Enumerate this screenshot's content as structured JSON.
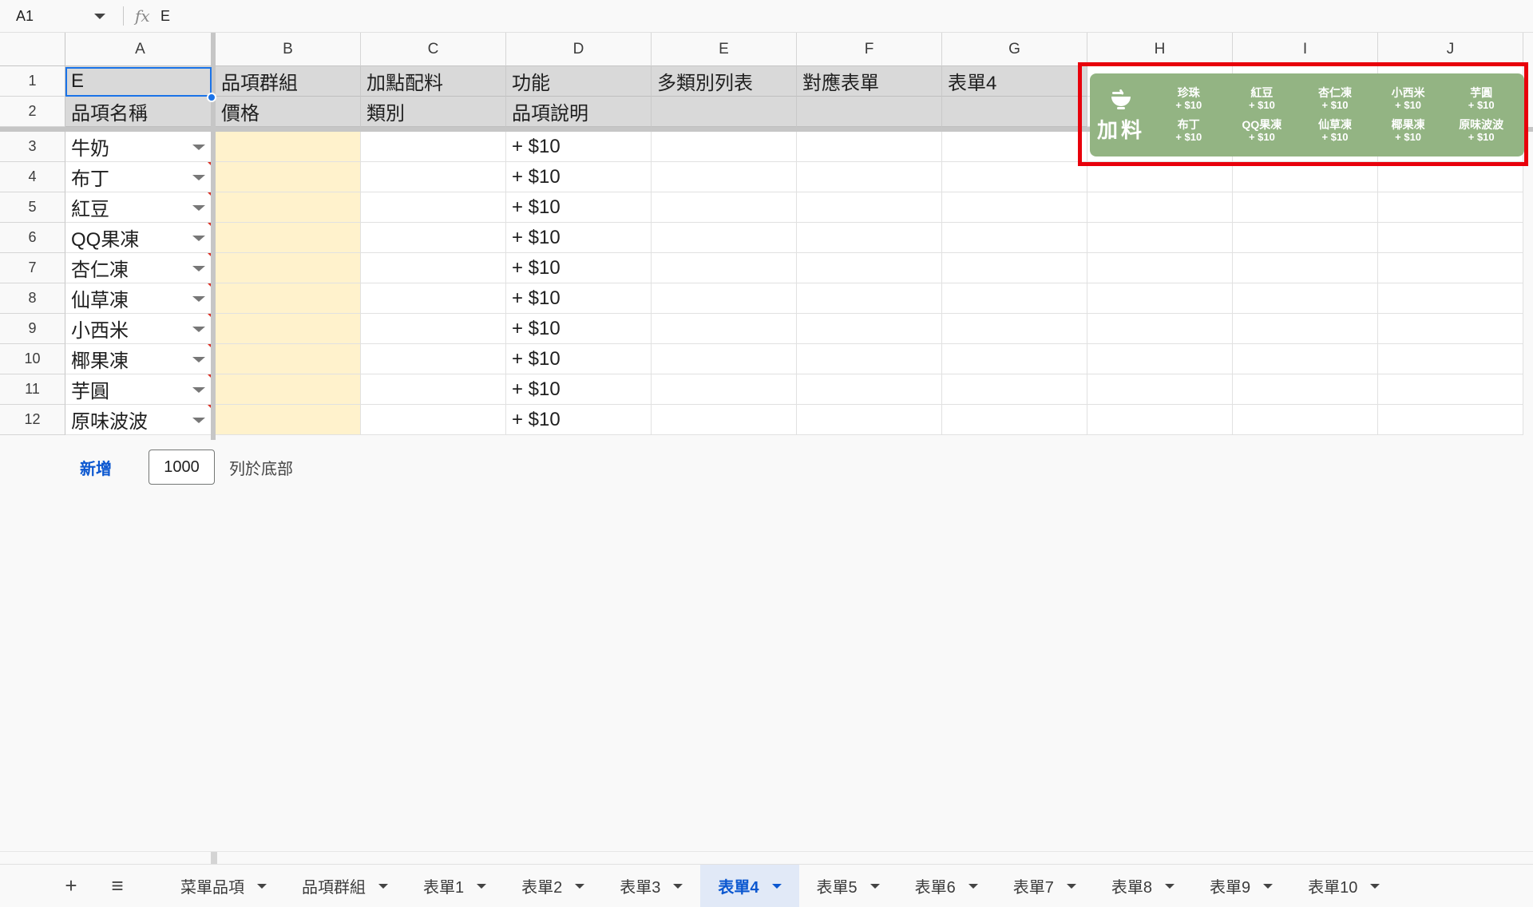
{
  "formula_bar": {
    "cell_ref": "A1",
    "fx_label": "fx",
    "value": "E"
  },
  "columns": [
    "A",
    "B",
    "C",
    "D",
    "E",
    "F",
    "G",
    "H",
    "I",
    "J"
  ],
  "rows": [
    "1",
    "2",
    "3",
    "4",
    "5",
    "6",
    "7",
    "8",
    "9",
    "10",
    "11",
    "12"
  ],
  "header_row1": [
    "E",
    "品項群組",
    "加點配料",
    "功能",
    "多類別列表",
    "對應表單",
    "表單4"
  ],
  "header_row2": [
    "品項名稱",
    "價格",
    "類別",
    "品項說明",
    "",
    "",
    ""
  ],
  "data_rows": [
    {
      "name": "牛奶",
      "desc": "+ $10"
    },
    {
      "name": "布丁",
      "desc": "+ $10"
    },
    {
      "name": "紅豆",
      "desc": "+ $10"
    },
    {
      "name": "QQ果凍",
      "desc": "+ $10"
    },
    {
      "name": "杏仁凍",
      "desc": "+ $10"
    },
    {
      "name": "仙草凍",
      "desc": "+ $10"
    },
    {
      "name": "小西米",
      "desc": "+ $10"
    },
    {
      "name": "椰果凍",
      "desc": "+ $10"
    },
    {
      "name": "芋圓",
      "desc": "+ $10"
    },
    {
      "name": "原味波波",
      "desc": "+ $10"
    }
  ],
  "banner": {
    "logo_text": "加料",
    "items": [
      {
        "name": "珍珠",
        "price": "+ $10"
      },
      {
        "name": "紅豆",
        "price": "+ $10"
      },
      {
        "name": "杏仁凍",
        "price": "+ $10"
      },
      {
        "name": "小西米",
        "price": "+ $10"
      },
      {
        "name": "芋圓",
        "price": "+ $10"
      },
      {
        "name": "布丁",
        "price": "+ $10"
      },
      {
        "name": "QQ果凍",
        "price": "+ $10"
      },
      {
        "name": "仙草凍",
        "price": "+ $10"
      },
      {
        "name": "椰果凍",
        "price": "+ $10"
      },
      {
        "name": "原味波波",
        "price": "+ $10"
      }
    ]
  },
  "add_rows": {
    "button_label": "新增",
    "count": "1000",
    "suffix": "列於底部"
  },
  "sheet_tabs": {
    "add_label": "+",
    "menu_label": "≡",
    "tabs": [
      "菜單品項",
      "品項群組",
      "表單1",
      "表單2",
      "表單3",
      "表單4",
      "表單5",
      "表單6",
      "表單7",
      "表單8",
      "表單9",
      "表單10"
    ],
    "active": "表單4"
  },
  "colors": {
    "accent": "#0b57d0",
    "header_fill": "#d9d9d9",
    "price_fill": "#fff2cc",
    "banner_green": "#93b483",
    "highlight_red": "#e8000b"
  }
}
